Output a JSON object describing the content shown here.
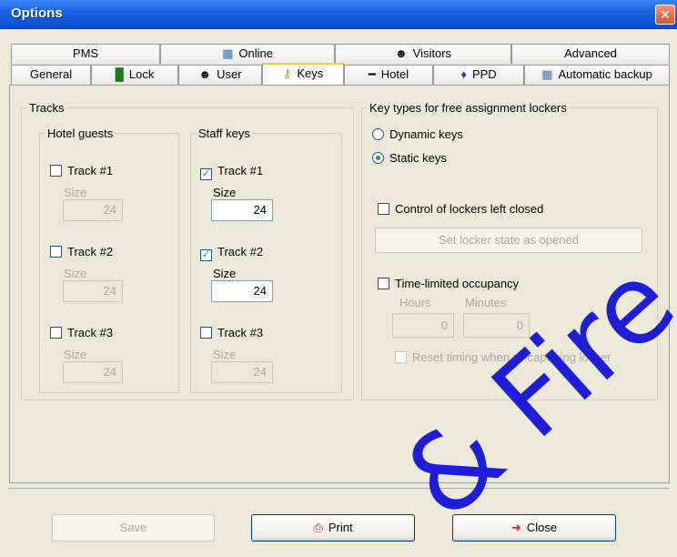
{
  "window": {
    "title": "Options",
    "close_glyph": "✕"
  },
  "tabs_row1": [
    {
      "label": "PMS",
      "icon": ""
    },
    {
      "label": "Online",
      "icon": "network-icon"
    },
    {
      "label": "Visitors",
      "icon": "visitors-icon"
    },
    {
      "label": "Advanced",
      "icon": ""
    }
  ],
  "tabs_row2": [
    {
      "label": "General",
      "icon": ""
    },
    {
      "label": "Lock",
      "icon": "lock-icon"
    },
    {
      "label": "User",
      "icon": "user-icon"
    },
    {
      "label": "Keys",
      "icon": "keys-icon",
      "active": true
    },
    {
      "label": "Hotel",
      "icon": "bed-icon"
    },
    {
      "label": "PPD",
      "icon": "ppd-icon"
    },
    {
      "label": "Automatic backup",
      "icon": "calendar-icon"
    }
  ],
  "tracks": {
    "label": "Tracks",
    "hotel_guests": {
      "label": "Hotel guests",
      "items": [
        {
          "label": "Track #1",
          "checked": false,
          "size_label": "Size",
          "size": "24"
        },
        {
          "label": "Track #2",
          "checked": false,
          "size_label": "Size",
          "size": "24"
        },
        {
          "label": "Track #3",
          "checked": false,
          "size_label": "Size",
          "size": "24"
        }
      ]
    },
    "staff_keys": {
      "label": "Staff keys",
      "items": [
        {
          "label": "Track #1",
          "checked": true,
          "size_label": "Size",
          "size": "24"
        },
        {
          "label": "Track #2",
          "checked": true,
          "size_label": "Size",
          "size": "24"
        },
        {
          "label": "Track #3",
          "checked": false,
          "size_label": "Size",
          "size": "24"
        }
      ]
    }
  },
  "lockers": {
    "label": "Key types for free assignment lockers",
    "dynamic": "Dynamic keys",
    "static": "Static keys",
    "selected": "Static keys",
    "control_closed": "Control of lockers left closed",
    "set_opened_button": "Set locker state as opened",
    "time_limited": "Time-limited occupancy",
    "hours_label": "Hours",
    "minutes_label": "Minutes",
    "hours_value": "0",
    "minutes_value": "0",
    "reset_timing": "Reset timing when re-capturing locker"
  },
  "buttons": {
    "save": "Save",
    "print": "Print",
    "close": "Close"
  },
  "watermark": "& Fire",
  "colors": {
    "titlebar": "#0A4FD0",
    "active_tab_accent": "#FFC83C",
    "check": "#21A121",
    "watermark": "#1414D8"
  }
}
